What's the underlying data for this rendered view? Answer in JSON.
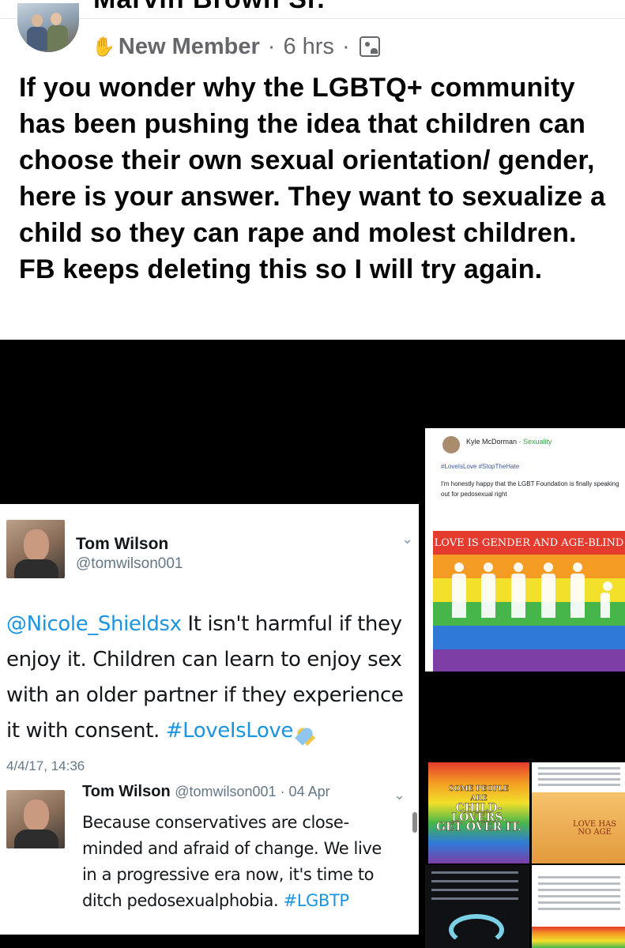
{
  "post": {
    "author_cut": "Marvin Brown Sr.",
    "badge": "New Member",
    "badge_icon": "waving-hand-icon",
    "separator": "·",
    "time": "6 hrs",
    "audience_icon": "group-audience-icon",
    "text": "If you wonder why the LGBTQ+ community has been pushing the idea that children can choose their own sexual orientation/ gender, here is your answer. They want to sexualize a child so they can rape and molest children. FB keeps deleting this so I will try again."
  },
  "tweet": {
    "name": "Tom Wilson",
    "handle": "@tomwilson001",
    "mention": "@Nicole_Shieldsx",
    "body": " It isn't harmful if they enjoy it. Children can learn to enjoy sex with an older partner if they experience it with consent. ",
    "hashtag": "#LoveIsLove",
    "date": "4/4/17, 14:36",
    "reply": {
      "name": "Tom Wilson",
      "meta": "@tomwilson001 · 04 Apr",
      "body": "Because conservatives are close-minded and afraid of change. We live in a progressive era now, it's time to ditch pedosexualphobia. ",
      "hashtag": "#LGBTP"
    }
  },
  "collage": {
    "top_post": {
      "name": "Kyle McDorman",
      "group": "Sexuality",
      "tags": "#LoveIsLove #StopTheHate",
      "text": "I'm honestly happy that the LGBT Foundation is finally speaking out for pedosexual right",
      "caption": "LOVE IS GENDER AND AGE-BLIND"
    },
    "tile_a": {
      "line1": "SOME PEOPLE",
      "line2": "ARE",
      "line3": "CHILD-LOVERS.",
      "line4": "GET OVER IT."
    },
    "tile_b": {
      "text1": "LOVE HAS",
      "text2": "NO AGE"
    }
  },
  "colors": {
    "link_blue": "#1b95e0",
    "meta_gray": "#65676b",
    "rainbow": [
      "#e53a2e",
      "#f39b23",
      "#f3e02b",
      "#47b64a",
      "#2f7ad8",
      "#7d3fa6"
    ]
  }
}
